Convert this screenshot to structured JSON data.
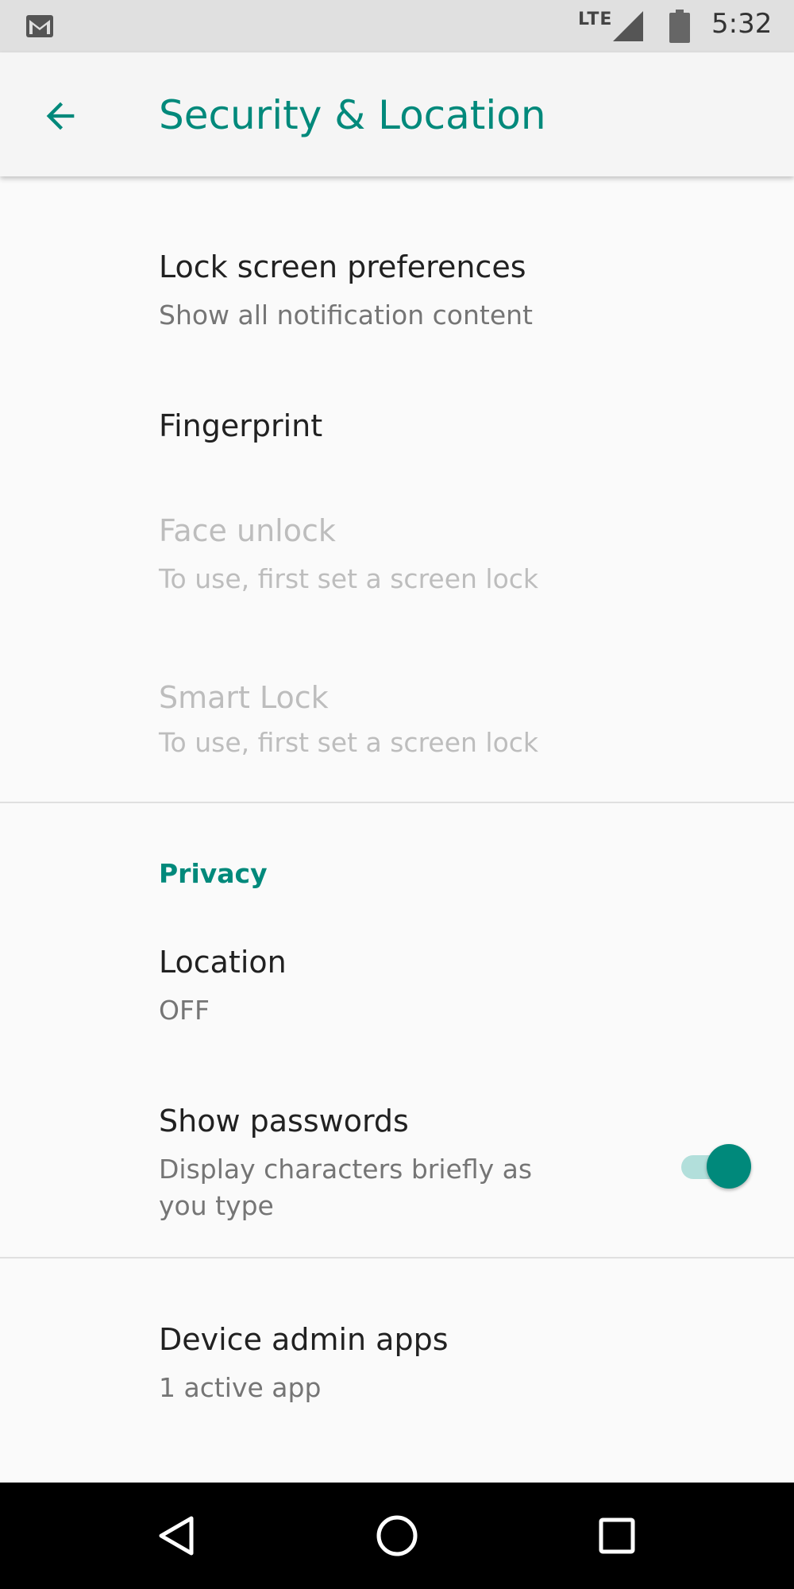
{
  "status_bar": {
    "network": "LTE",
    "time": "5:32",
    "icons": [
      "gmail-icon",
      "signal-icon",
      "battery-icon"
    ]
  },
  "app_bar": {
    "title": "Security & Location",
    "back_icon": "arrow-back-icon"
  },
  "items": [
    {
      "title": "Lock screen preferences",
      "summary": "Show all notification content",
      "enabled": true
    },
    {
      "title": "Fingerprint",
      "summary": "",
      "enabled": true
    },
    {
      "title": "Face unlock",
      "summary": "To use, first set a screen lock",
      "enabled": false
    },
    {
      "title": "Smart Lock",
      "summary": "To use, first set a screen lock",
      "enabled": false
    }
  ],
  "privacy": {
    "header": "Privacy",
    "location": {
      "title": "Location",
      "summary": "OFF"
    },
    "show_passwords": {
      "title": "Show passwords",
      "summary_line1": "Display characters briefly as",
      "summary_line2": "you type",
      "checked": true
    }
  },
  "device_admin": {
    "title": "Device admin apps",
    "summary": "1 active app"
  },
  "nav_bar": {
    "buttons": [
      "back-triangle-icon",
      "home-circle-icon",
      "recents-square-icon"
    ]
  },
  "colors": {
    "accent": "#00897b",
    "accent_light": "#b2dfdb",
    "title_text": "#212121",
    "summary_text": "#757575",
    "disabled_text": "#bdbdbd"
  }
}
